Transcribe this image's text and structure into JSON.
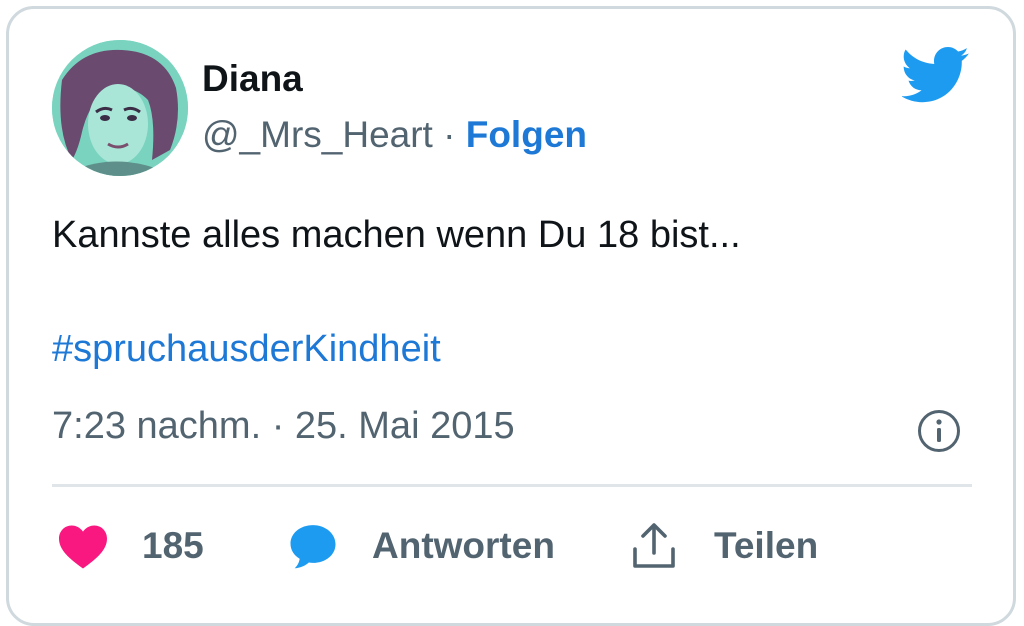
{
  "author": {
    "display_name": "Diana",
    "handle": "@_Mrs_Heart",
    "separator": " · ",
    "follow_label": "Folgen"
  },
  "tweet": {
    "text": "Kannste alles machen wenn Du 18 bist...",
    "hashtag": "#spruchausderKindheit",
    "timestamp": "7:23 nachm. · 25. Mai 2015"
  },
  "actions": {
    "likes_count": "185",
    "reply_label": "Antworten",
    "share_label": "Teilen"
  },
  "colors": {
    "link": "#1d78d6",
    "twitter_blue": "#1d9bf0",
    "like_red": "#f91880",
    "muted": "#536471"
  },
  "icons": {
    "brand": "twitter-bird-icon",
    "info": "info-icon",
    "like": "heart-icon",
    "reply": "speech-bubble-icon",
    "share": "share-icon"
  }
}
